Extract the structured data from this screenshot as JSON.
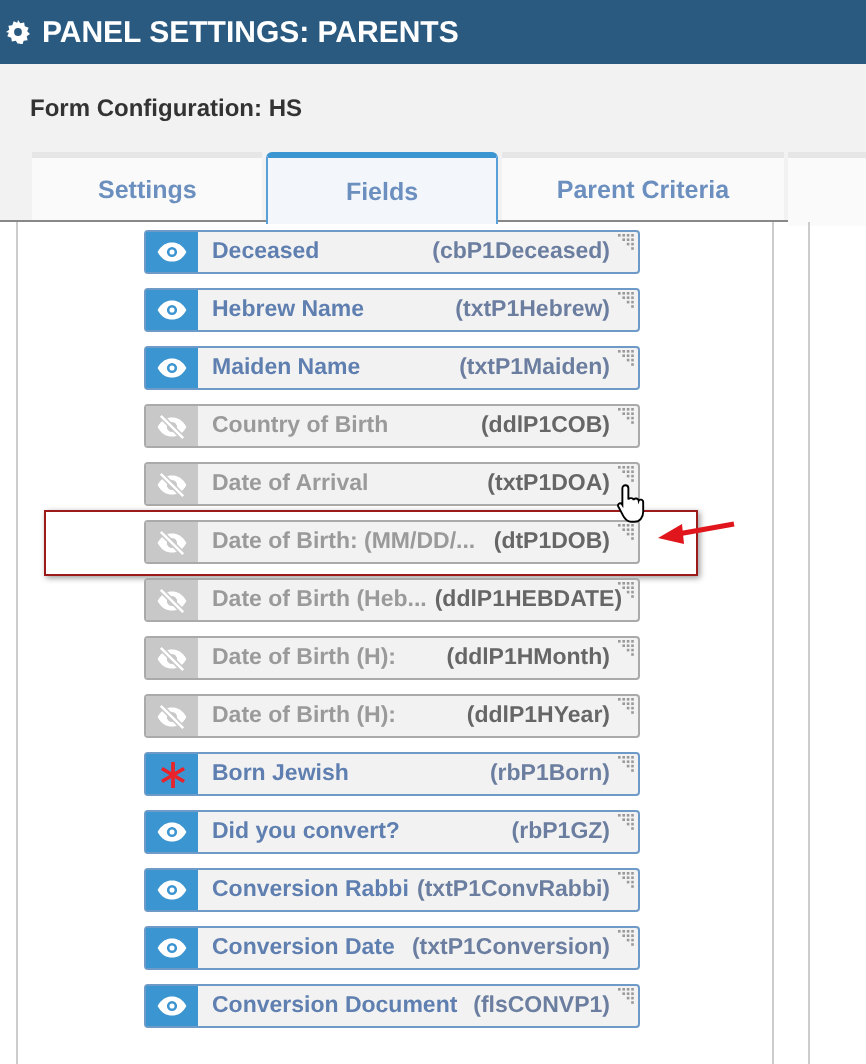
{
  "header": {
    "title": "PANEL SETTINGS: PARENTS"
  },
  "form_configuration": "Form Configuration: HS",
  "tabs": [
    {
      "label": "Settings",
      "selected": false
    },
    {
      "label": "Fields",
      "selected": true
    },
    {
      "label": "Parent Criteria",
      "selected": false
    }
  ],
  "fields": [
    {
      "label": "Deceased",
      "code": "(cbP1Deceased)",
      "kind": "visible",
      "highlighted": false
    },
    {
      "label": "Hebrew Name",
      "code": "(txtP1Hebrew)",
      "kind": "visible",
      "highlighted": false
    },
    {
      "label": "Maiden Name",
      "code": "(txtP1Maiden)",
      "kind": "visible",
      "highlighted": false
    },
    {
      "label": "Country of Birth",
      "code": "(ddlP1COB)",
      "kind": "hidden",
      "highlighted": false
    },
    {
      "label": "Date of Arrival",
      "code": "(txtP1DOA)",
      "kind": "hidden",
      "highlighted": false
    },
    {
      "label": "Date of Birth: (MM/DD/...",
      "code": "(dtP1DOB)",
      "kind": "hidden",
      "highlighted": true
    },
    {
      "label": "Date of Birth (Heb...",
      "code": "(ddlP1HEBDATE)",
      "kind": "hidden",
      "highlighted": false
    },
    {
      "label": "Date of Birth (H):",
      "code": "(ddlP1HMonth)",
      "kind": "hidden",
      "highlighted": false
    },
    {
      "label": "Date of Birth (H):",
      "code": "(ddlP1HYear)",
      "kind": "hidden",
      "highlighted": false
    },
    {
      "label": "Born Jewish",
      "code": "(rbP1Born)",
      "kind": "required",
      "highlighted": false
    },
    {
      "label": "Did you convert?",
      "code": "(rbP1GZ)",
      "kind": "visible",
      "highlighted": false
    },
    {
      "label": "Conversion Rabbi",
      "code": "(txtP1ConvRabbi)",
      "kind": "visible",
      "highlighted": false
    },
    {
      "label": "Conversion Date",
      "code": "(txtP1Conversion)",
      "kind": "visible",
      "highlighted": false
    },
    {
      "label": "Conversion Document",
      "code": "(flsCONVP1)",
      "kind": "visible",
      "highlighted": false
    }
  ]
}
